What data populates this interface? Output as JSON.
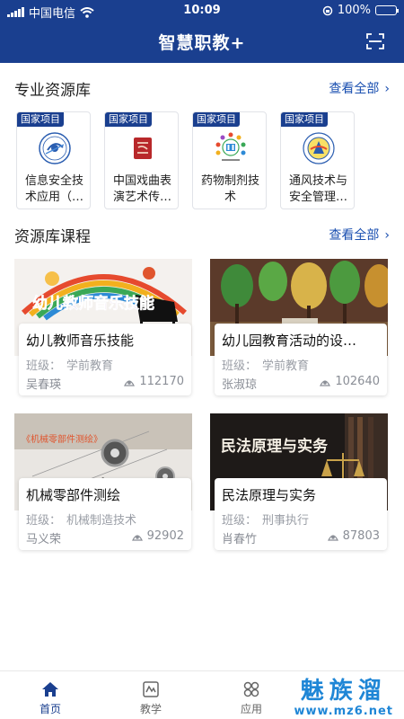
{
  "status_bar": {
    "carrier": "中国电信",
    "time": "10:09",
    "battery": "100%"
  },
  "header": {
    "title": "智慧职教+",
    "scan_icon": "scan-icon"
  },
  "resource_section": {
    "title": "专业资源库",
    "see_all": "查看全部",
    "items": [
      {
        "tag": "国家项目",
        "name": "信息安全技术应用（…",
        "icon": "network-security-logo"
      },
      {
        "tag": "国家项目",
        "name": "中国戏曲表演艺术传…",
        "icon": "opera-seal-logo"
      },
      {
        "tag": "国家项目",
        "name": "药物制剂技术",
        "icon": "pharmacy-logo"
      },
      {
        "tag": "国家项目",
        "name": "通风技术与安全管理…",
        "icon": "ventilation-logo"
      }
    ]
  },
  "course_section": {
    "title": "资源库课程",
    "see_all": "查看全部",
    "class_prefix": "班级：",
    "courses": [
      {
        "title": "幼儿教师音乐技能",
        "class": "学前教育",
        "teacher": "吴春瑛",
        "views": "112170",
        "cover_text": "幼儿教师音乐技能"
      },
      {
        "title": "幼儿园教育活动的设…",
        "class": "学前教育",
        "teacher": "张淑琼",
        "views": "102640",
        "cover_text": ""
      },
      {
        "title": "机械零部件测绘",
        "class": "机械制造技术",
        "teacher": "马义荣",
        "views": "92902",
        "cover_text": "《机械零部件测绘》"
      },
      {
        "title": "民法原理与实务",
        "class": "刑事执行",
        "teacher": "肖春竹",
        "views": "87803",
        "cover_text": "民法原理与实务"
      }
    ]
  },
  "tabbar": {
    "active": "home",
    "tabs": [
      {
        "id": "home",
        "label": "首页",
        "icon": "home-icon"
      },
      {
        "id": "teach",
        "label": "教学",
        "icon": "teaching-icon"
      },
      {
        "id": "apps",
        "label": "应用",
        "icon": "apps-icon"
      }
    ]
  },
  "watermark": {
    "line1": "魅族溜",
    "line2": "www.mz6.net"
  },
  "colors": {
    "brand": "#1a3f8f",
    "link": "#1a4fb0",
    "watermark": "#1f86d6"
  }
}
